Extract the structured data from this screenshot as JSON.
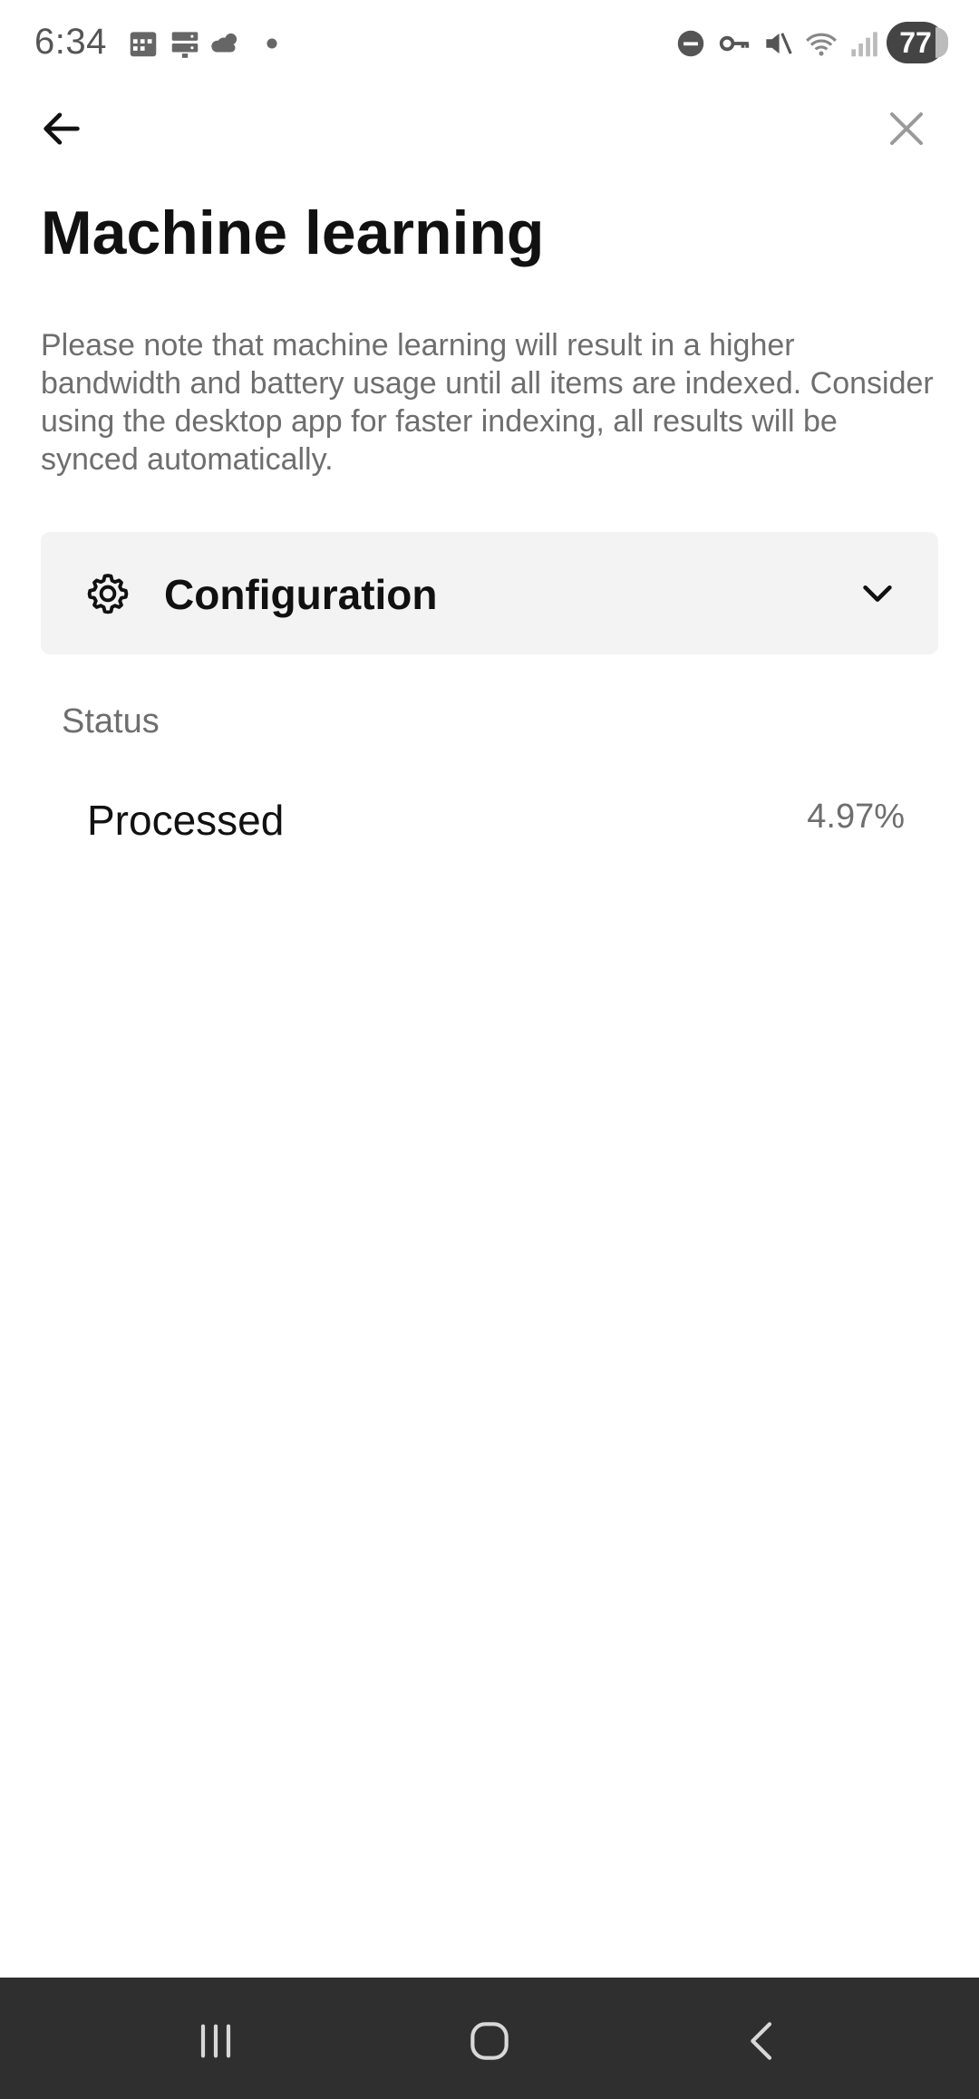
{
  "status_bar": {
    "time": "6:34",
    "battery": "77",
    "icons": [
      "calendar-icon",
      "server-icon",
      "weather-icon",
      "dot-icon",
      "dnd-icon",
      "key-icon",
      "mute-icon",
      "wifi-icon",
      "signal-icon"
    ]
  },
  "header": {
    "back_icon": "arrow-left-icon",
    "close_icon": "close-icon",
    "title": "Machine learning"
  },
  "description": "Please note that machine learning will result in a higher bandwidth and battery usage until all items are indexed. Consider using the desktop app for faster indexing, all results will be synced automatically.",
  "configuration": {
    "label": "Configuration",
    "icon": "gear-icon",
    "expand_icon": "chevron-down-icon"
  },
  "status": {
    "heading": "Status",
    "processed_label": "Processed",
    "processed_value": "4.97%"
  },
  "nav_bar": {
    "buttons": [
      "recents-icon",
      "home-icon",
      "back-icon"
    ]
  },
  "colors": {
    "background": "#ffffff",
    "card": "#f3f3f3",
    "muted_text": "#6e6e6e",
    "nav_bar": "#2f2f2f"
  }
}
